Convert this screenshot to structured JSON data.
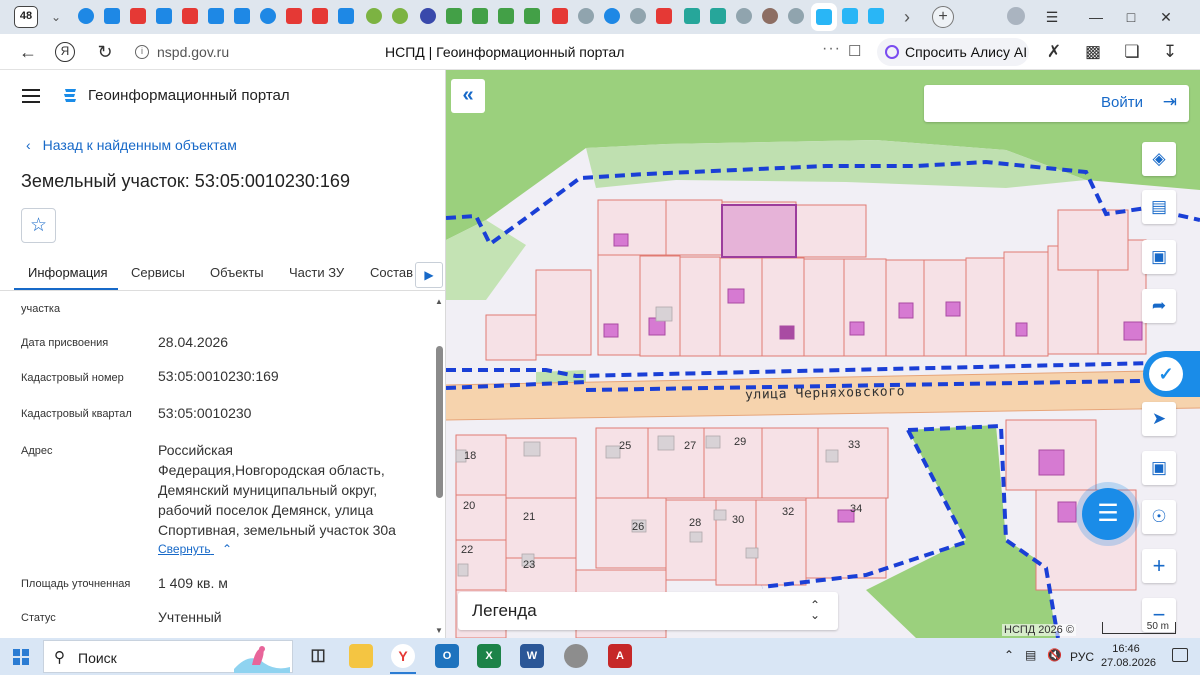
{
  "browser": {
    "tab_count": "48",
    "url": "nspd.gov.ru",
    "page_title": "НСПД | Геоинформационный портал",
    "alice_label": "Спросить Алису AI"
  },
  "panel": {
    "brand": "Геоинформационный портал",
    "back_link": "Назад к найденным объектам",
    "title": "Земельный участок: 53:05:0010230:169",
    "tabs": [
      "Информация",
      "Сервисы",
      "Объекты",
      "Части ЗУ",
      "Состав"
    ],
    "partial_label": "участка",
    "fields": {
      "date_label": "Дата присвоения",
      "date_value": "28.04.2026",
      "cadnum_label": "Кадастровый номер",
      "cadnum_value": "53:05:0010230:169",
      "quarter_label": "Кадастровый квартал",
      "quarter_value": "53:05:0010230",
      "address_label": "Адрес",
      "address_lines": [
        "Российская",
        "Федерация,Новгородская область,",
        "Демянский муниципальный округ,",
        "рабочий поселок Демянск, улица",
        "Спортивная, земельный участок 30а"
      ],
      "collapse_link": "Свернуть",
      "area_label": "Площадь уточненная",
      "area_value": "1 409 кв. м",
      "status_label": "Статус",
      "status_value": "Учтенный"
    }
  },
  "map": {
    "login_label": "Войти",
    "street_label": "улица Черняховского",
    "legend_label": "Легенда",
    "copyright": "НСПД 2026 ©",
    "scale_label": "50 m",
    "house_numbers": [
      "25",
      "27",
      "29",
      "33",
      "18",
      "20",
      "21",
      "22",
      "23",
      "26",
      "28",
      "30",
      "32",
      "34"
    ],
    "accent_color": "#1769c8",
    "boundary_color": "#1a3fd6"
  },
  "taskbar": {
    "search_label": "Поиск",
    "lang": "РУС",
    "time": "16:46",
    "date": "27.08.2026"
  }
}
